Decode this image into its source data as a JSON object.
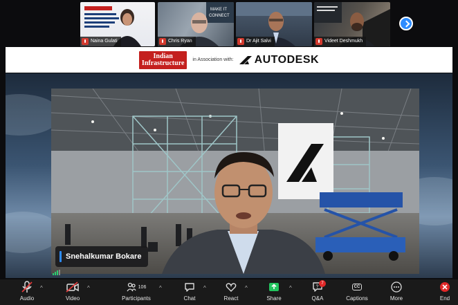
{
  "participants": [
    {
      "name": "Naina Gulati"
    },
    {
      "name": "Chris Ryan"
    },
    {
      "name": "Dr Ajit Salvi"
    },
    {
      "name": "Videet Deshmukh"
    }
  ],
  "banner": {
    "logo_line1": "Indian",
    "logo_line2": "Infrastructure",
    "association_text": "in Association with:",
    "sponsor": "AUTODESK"
  },
  "speaker": {
    "name": "Snehalkumar Bokare"
  },
  "toolbar": {
    "audio": "Audio",
    "video": "Video",
    "participants": "Participants",
    "participants_count": "106",
    "chat": "Chat",
    "react": "React",
    "share": "Share",
    "qa": "Q&A",
    "qa_badge": "7",
    "captions": "Captions",
    "captions_icon_text": "CC",
    "more": "More",
    "end": "End"
  },
  "colors": {
    "accent": "#2d8cff",
    "share": "#22c55e",
    "muted": "#d23a2f",
    "logo_red": "#c4201e"
  }
}
